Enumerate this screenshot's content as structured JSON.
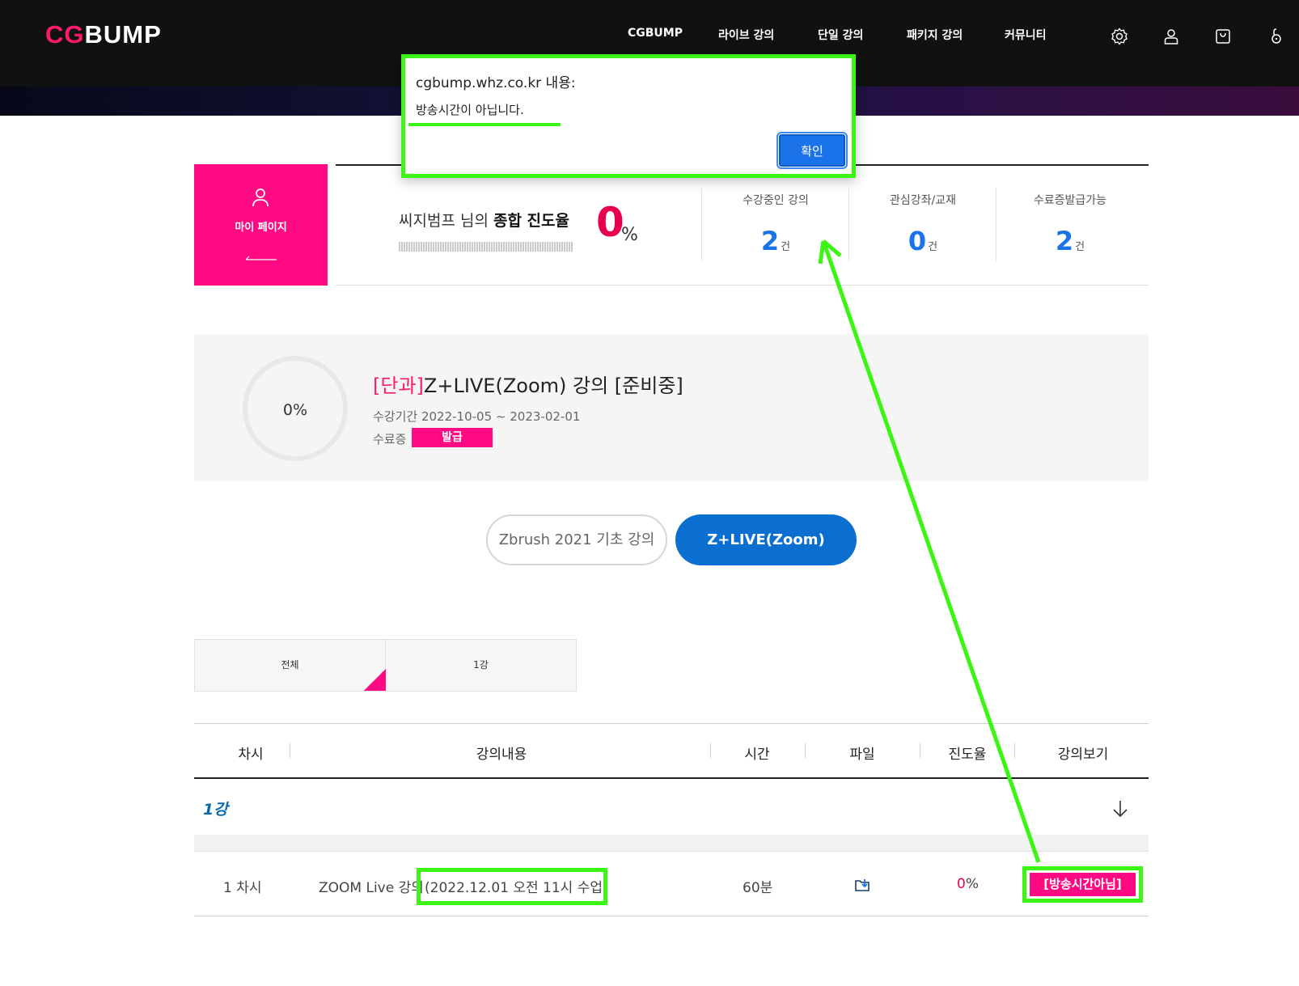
{
  "header": {
    "logo_cg": "CG",
    "logo_bump": "BUMP",
    "nav": [
      "CGBUMP",
      "라이브 강의",
      "단일 강의",
      "패키지 강의",
      "커뮤니티"
    ],
    "icons": [
      "gear-icon",
      "user-icon",
      "cart-icon",
      "lock-icon"
    ]
  },
  "dialog": {
    "title": "cgbump.whz.co.kr 내용:",
    "message": "방송시간이 아닙니다.",
    "ok_label": "확인"
  },
  "mypage": {
    "label": "마이 페이지",
    "progress_prefix": "씨지범프 님의 ",
    "progress_bold": "종합 진도율",
    "progress_value": "0",
    "progress_unit": "%",
    "stats": [
      {
        "label": "수강중인 강의",
        "value": "2",
        "unit": "건"
      },
      {
        "label": "관심강좌/교재",
        "value": "0",
        "unit": "건"
      },
      {
        "label": "수료증발급가능",
        "value": "2",
        "unit": "건"
      }
    ]
  },
  "course": {
    "progress_text": "0%",
    "tag": "[단과]",
    "title": "Z+LIVE(Zoom) 강의 [준비중]",
    "period": "수강기간 2022-10-05 ~ 2023-02-01",
    "cert_label": "수료증",
    "cert_button": "발급"
  },
  "course_tabs": [
    "Zbrush 2021 기초 강의",
    "Z+LIVE(Zoom)"
  ],
  "chapter_tabs": [
    "전체",
    "1강"
  ],
  "table": {
    "headers": [
      "차시",
      "강의내용",
      "시간",
      "파일",
      "진도율",
      "강의보기"
    ],
    "group_label": "1강",
    "rows": [
      {
        "session": "1 차시",
        "content": "ZOOM Live 강의",
        "date_note": "(2022.12.01 오전 11시 수업)",
        "duration": "60분",
        "progress_value": "0",
        "progress_unit": "%",
        "view_label": "[방송시간아님]"
      }
    ]
  },
  "colors": {
    "accent_pink": "#ff0a82",
    "accent_blue": "#1a73e8",
    "annotation_green": "#3df514"
  }
}
